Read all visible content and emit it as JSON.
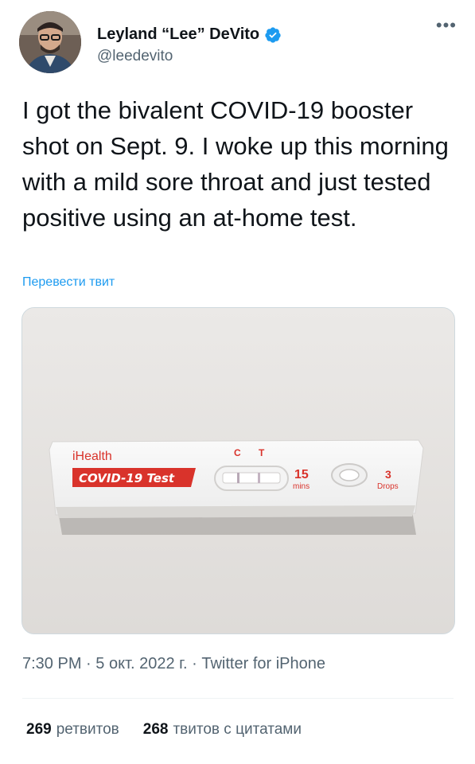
{
  "author": {
    "display_name": "Leyland “Lee” DeVito",
    "handle": "@leedevito",
    "verified_icon": "verified-badge-icon",
    "more_icon": "more-options-icon"
  },
  "tweet": {
    "text": "I got the bivalent COVID-19 booster shot on Sept. 9. I woke up this morning with a mild sore throat and just tested positive using an at-home test.",
    "translate_label": "Перевести твит"
  },
  "media": {
    "brand": "iHealth",
    "product": "COVID-19 Test",
    "line_c": "C",
    "line_t": "T",
    "time_value": "15",
    "time_unit": "mins",
    "drops_value": "3",
    "drops_unit": "Drops"
  },
  "meta": {
    "time": "7:30 PM",
    "date": "5 окт. 2022 г.",
    "source": "Twitter for iPhone",
    "separator": "·"
  },
  "stats": {
    "retweets_count": "269",
    "retweets_label": "ретвитов",
    "quotes_count": "268",
    "quotes_label": "твитов с цитатами"
  },
  "colors": {
    "accent": "#1d9bf0",
    "text": "#0f1419",
    "secondary": "#536471",
    "test_red": "#d9332b"
  }
}
